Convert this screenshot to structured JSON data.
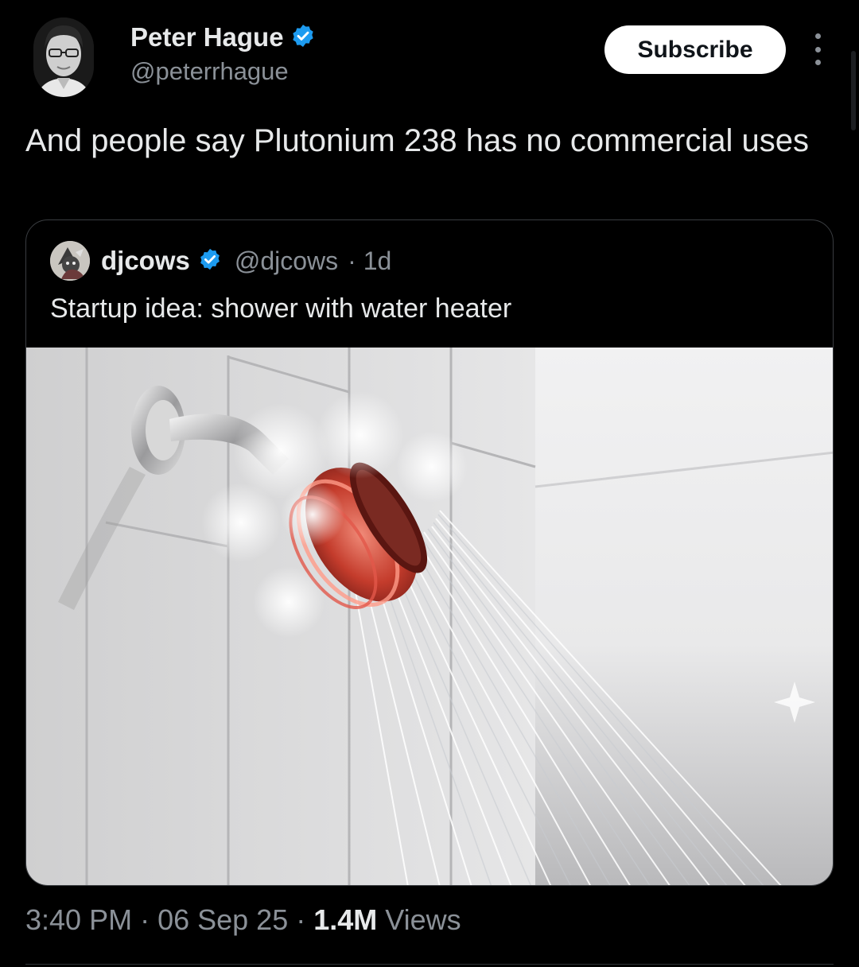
{
  "author": {
    "name": "Peter Hague",
    "handle": "@peterrhague",
    "verified": true,
    "verified_color": "#1d9bf0"
  },
  "subscribe_label": "Subscribe",
  "more_icon": "more-vertical-icon",
  "tweet_text": "And people say Plutonium 238 has no commercial uses",
  "quote": {
    "name": "djcows",
    "handle": "@djcows",
    "time": "· 1d",
    "verified": true,
    "text": "Startup idea: shower with water heater"
  },
  "footer": {
    "time": "3:40 PM",
    "date": "06 Sep 25",
    "views_count": "1.4M",
    "views_label": "Views"
  }
}
